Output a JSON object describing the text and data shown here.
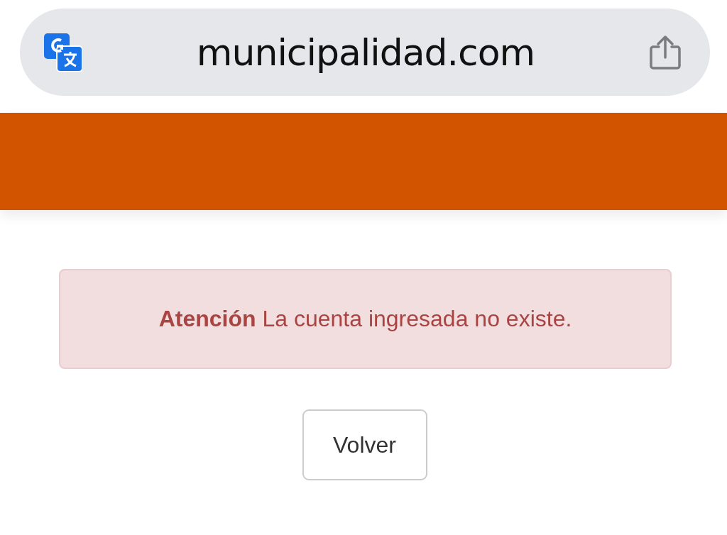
{
  "address_bar": {
    "url": "municipalidad.com"
  },
  "alert": {
    "message": "**Atención** La cuenta ingresada no existe."
  },
  "buttons": [
    {
      "label": "Volver"
    }
  ]
}
